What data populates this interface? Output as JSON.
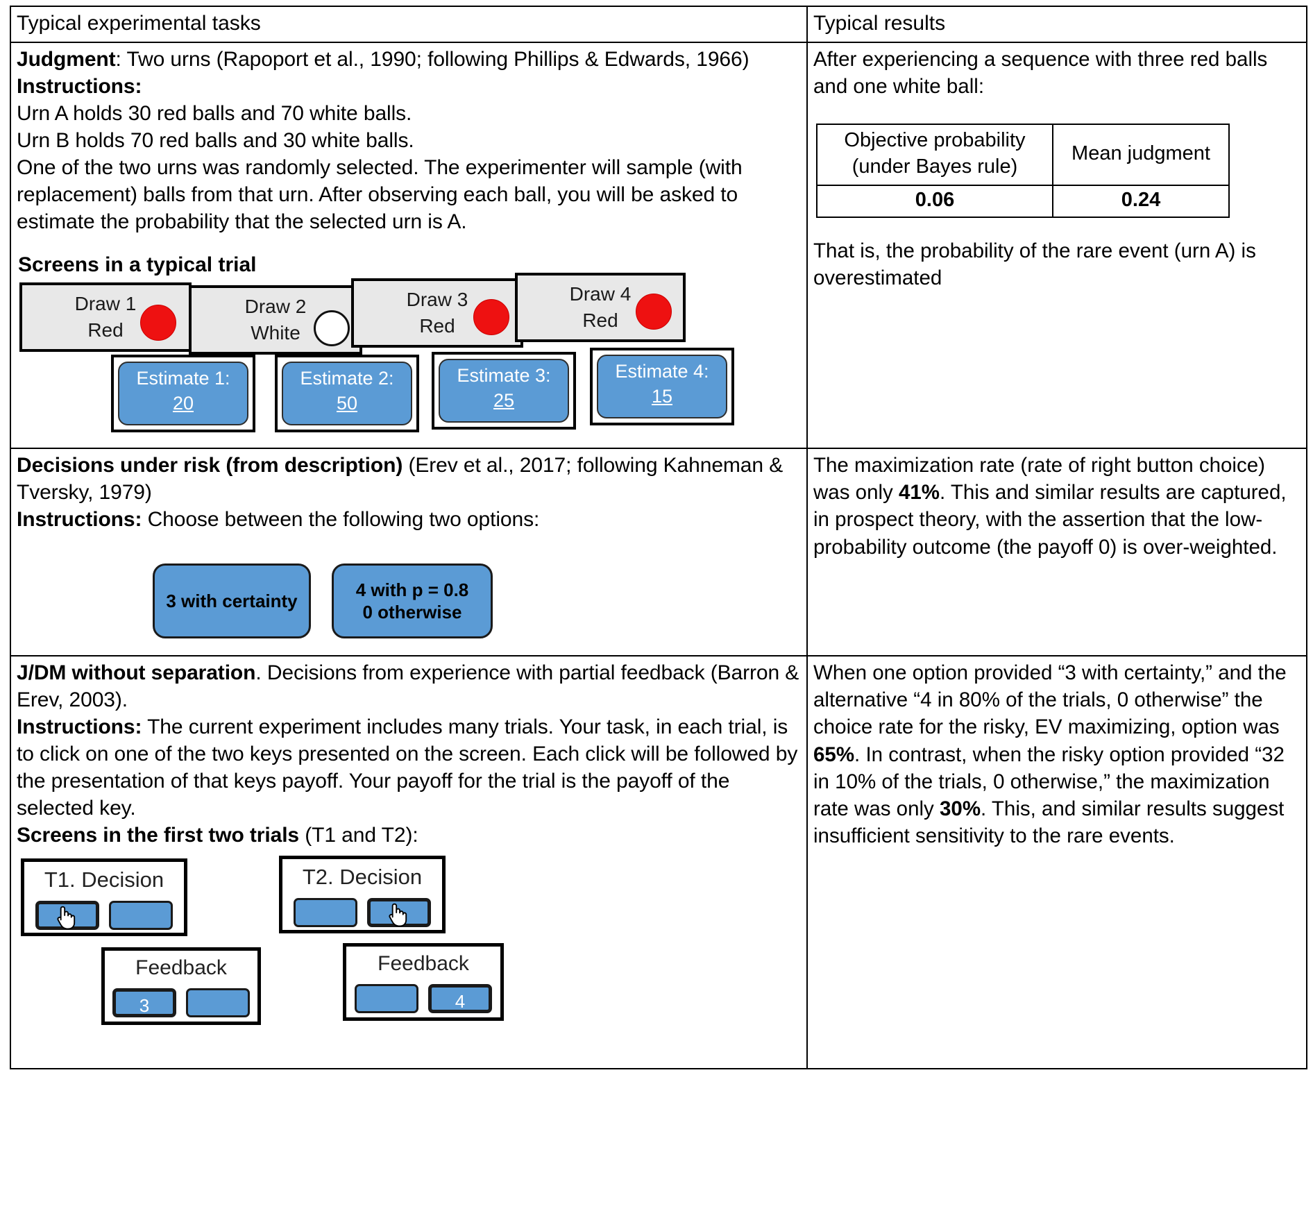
{
  "header": {
    "left": "Typical experimental tasks",
    "right": "Typical results"
  },
  "row1": {
    "title_bold": "Judgment",
    "title_rest": ":  Two urns (Rapoport et al., 1990; following Phillips & Edwards, 1966)",
    "instructions_label": "Instructions:",
    "lines": [
      "Urn A holds 30 red balls and 70 white balls.",
      "Urn B holds 70 red balls and 30 white balls.",
      "One of the two urns was randomly selected. The experimenter will sample (with replacement) balls from that urn. After observing each ball, you will be asked to estimate the probability that the selected urn is A."
    ],
    "screens_title": "Screens in a typical trial",
    "draws": [
      {
        "title": "Draw 1",
        "outcome": "Red",
        "ball": "red-ball-icon"
      },
      {
        "title": "Draw 2",
        "outcome": "White",
        "ball": "white-ball-icon"
      },
      {
        "title": "Draw 3",
        "outcome": "Red",
        "ball": "red-ball-icon"
      },
      {
        "title": "Draw 4",
        "outcome": "Red",
        "ball": "red-ball-icon"
      }
    ],
    "estimates": [
      {
        "label": "Estimate 1:",
        "value": "20"
      },
      {
        "label": "Estimate 2:",
        "value": "50"
      },
      {
        "label": "Estimate 3:",
        "value": "25"
      },
      {
        "label": "Estimate 4:",
        "value": "15"
      }
    ],
    "results": {
      "intro": "After experiencing a sequence with three red balls and one white ball:",
      "table": {
        "headers": [
          "Objective probability (under Bayes rule)",
          "Mean judgment"
        ],
        "values": [
          "0.06",
          "0.24"
        ]
      },
      "note": "That is, the probability of the rare event (urn A) is overestimated"
    }
  },
  "row2": {
    "title_bold": "Decisions under risk (from description)",
    "title_rest": " (Erev et al., 2017; following Kahneman & Tversky, 1979)",
    "instructions_label": "Instructions:",
    "instructions_rest": " Choose between the following two options:",
    "options": [
      {
        "line1": "3 with certainty",
        "line2": ""
      },
      {
        "line1": "4 with p = 0.8",
        "line2": "0 otherwise"
      }
    ],
    "results": {
      "pre1": "The maximization rate (rate of right button choice) was only ",
      "bold1": "41%",
      "post1": ". This and similar results are captured, in prospect theory, with the assertion that the low-probability outcome (the payoff 0) is over-weighted."
    }
  },
  "row3": {
    "title_bold": "J/DM without separation",
    "title_rest": ". Decisions from experience with partial feedback (Barron & Erev, 2003).",
    "instructions_label": "Instructions:",
    "instructions_rest": " The current experiment includes many trials. Your task, in each trial, is to click on one of the two keys presented on the screen. Each click will be followed by the presentation of that keys payoff. Your payoff for the trial is the payoff of the selected key.",
    "screens_bold": "Screens in the first two trials",
    "screens_rest": " (T1 and T2):",
    "trials": [
      {
        "decision_title": "T1. Decision",
        "keys": [
          {
            "value": "",
            "cursor": true,
            "selected": true
          },
          {
            "value": "",
            "cursor": false,
            "selected": false
          }
        ],
        "feedback_title": "Feedback",
        "feedback_keys": [
          {
            "value": "3",
            "selected": true
          },
          {
            "value": "",
            "selected": false
          }
        ]
      },
      {
        "decision_title": "T2. Decision",
        "keys": [
          {
            "value": "",
            "cursor": false,
            "selected": false
          },
          {
            "value": "",
            "cursor": true,
            "selected": true
          }
        ],
        "feedback_title": "Feedback",
        "feedback_keys": [
          {
            "value": "",
            "selected": false
          },
          {
            "value": "4",
            "selected": true
          }
        ]
      }
    ],
    "results": {
      "pre1": "When one option provided “3 with certainty,” and the alternative “4 in 80% of the trials, 0 otherwise” the choice rate for the risky, EV maximizing, option was ",
      "bold1": "65%",
      "mid": ". In contrast, when the risky option provided “32 in 10% of the trials, 0 otherwise,” the maximization rate was only ",
      "bold2": "30%",
      "post": ". This, and similar results suggest insufficient sensitivity to the rare events."
    }
  },
  "colors": {
    "key_blue": "#5b9bd5",
    "draw_grey": "#e8e8e8",
    "red_ball": "#ee1111"
  }
}
